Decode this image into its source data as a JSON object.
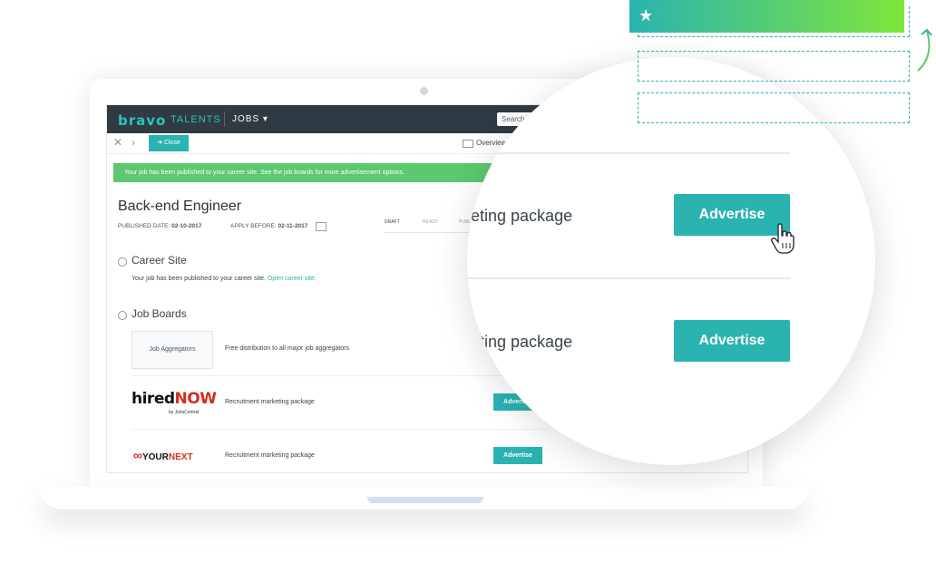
{
  "navbar": {
    "logo_bravo": "bravo",
    "logo_talents": "TALENTS",
    "jobs_label": "JOBS",
    "jobs_caret": "▾",
    "search_placeholder": "Search j"
  },
  "toolbar": {
    "close_x": "✕",
    "arrow": "›",
    "close_button": "➜ Close",
    "overview": "Overview"
  },
  "banner": {
    "text": "Your job has been published to your career site. See the job boards for more advertisement options."
  },
  "job": {
    "title": "Back-end Engineer",
    "published_label": "PUBLISHED DATE:",
    "published_date": "02-10-2017",
    "apply_label": "APPLY BEFORE:",
    "apply_date": "02-11-2017",
    "status_steps": [
      "DRAFT",
      "READY",
      "PUBLI"
    ]
  },
  "career_site": {
    "title": "Career Site",
    "description": "Your job has been published to your career site.",
    "link": "Open career site."
  },
  "job_boards": {
    "title": "Job Boards",
    "rows": [
      {
        "name": "Job Aggregators",
        "description": "Free distribution to all major job aggregators"
      },
      {
        "name": "hiredNOW",
        "logo_main": "hired",
        "logo_accent": "NOW",
        "logo_sub": "by JobsCentral",
        "description": "Recruitment marketing package",
        "button": "Advertise"
      },
      {
        "name": "YOURNEXT",
        "logo_inf": "∞",
        "logo_main": "YOUR",
        "logo_accent": "NEXT",
        "description": "Recruitment marketing package",
        "button": "Advertise"
      }
    ]
  },
  "magnifier": {
    "rows": [
      {
        "text": "eting package",
        "button": "Advertise"
      },
      {
        "text": "eting package",
        "button": "Advertise"
      }
    ]
  },
  "colors": {
    "accent": "#2ab3b1",
    "navbar": "#2f3a43",
    "banner": "#5cc86f",
    "brand_red": "#d32f1f",
    "gradient_end": "#7fe63b"
  },
  "icons": {
    "favorite": "star-icon",
    "pointer": "hand-pointer-icon",
    "calendar": "calendar-icon",
    "overview": "overview-icon",
    "refresh_arrow": "curved-arrow-icon"
  }
}
